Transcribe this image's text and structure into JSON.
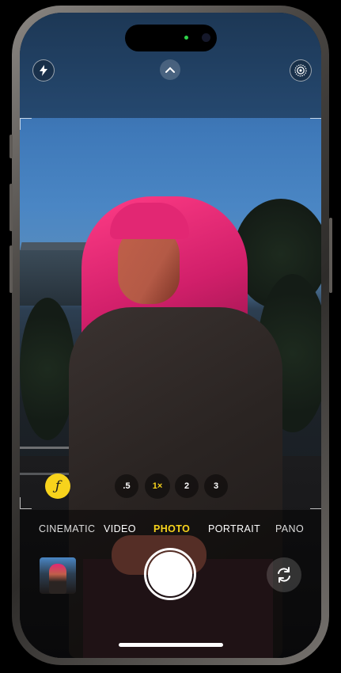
{
  "app": {
    "name": "Camera"
  },
  "top_controls": {
    "flash_icon": "bolt-icon",
    "chevron_icon": "chevron-up-icon",
    "live_icon": "live-photo-icon"
  },
  "aperture": {
    "glyph": "ƒ"
  },
  "zoom": {
    "options": [
      ".5",
      "1×",
      "2",
      "3"
    ],
    "selected": "1×"
  },
  "modes": {
    "items": [
      "CINEMATIC",
      "VIDEO",
      "PHOTO",
      "PORTRAIT",
      "PANO"
    ],
    "selected": "PHOTO"
  },
  "bottom_controls": {
    "thumbnail_icon": "last-photo-thumbnail",
    "shutter_icon": "shutter-button",
    "flip_icon": "camera-flip-icon"
  },
  "colors": {
    "accent_yellow": "#f7d31c",
    "hair_pink": "#e22773"
  }
}
